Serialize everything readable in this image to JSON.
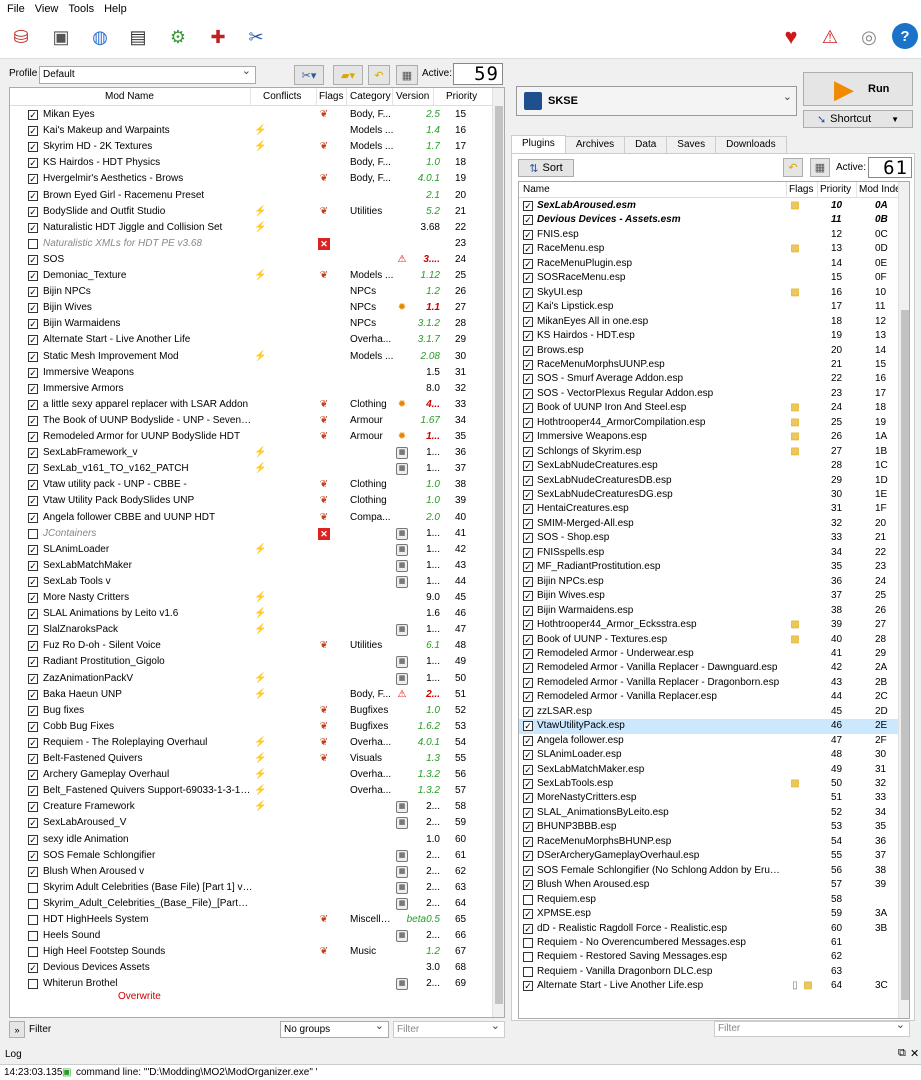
{
  "menu": [
    "File",
    "View",
    "Tools",
    "Help"
  ],
  "profile": {
    "label": "Profile",
    "value": "Default",
    "active_label": "Active:",
    "active_count": "59"
  },
  "executable": {
    "value": "SKSE",
    "run_label": "Run",
    "shortcut_label": "Shortcut"
  },
  "mod_columns": [
    "Mod Name",
    "Conflicts",
    "Flags",
    "Category",
    "Version",
    "Priority"
  ],
  "mods": [
    {
      "c": true,
      "n": "Mikan Eyes",
      "cf": "",
      "fl": "flag",
      "cat": "Body, F...",
      "v": "2.5",
      "vc": "g",
      "p": "15"
    },
    {
      "c": true,
      "n": "Kai's Makeup and Warpaints",
      "cf": "y",
      "fl": "",
      "cat": "Models ...",
      "v": "1.4",
      "vc": "g",
      "p": "16"
    },
    {
      "c": true,
      "n": "Skyrim HD - 2K Textures",
      "cf": "y",
      "fl": "flag",
      "cat": "Models ...",
      "v": "1.7",
      "vc": "g",
      "p": "17"
    },
    {
      "c": true,
      "n": "KS Hairdos - HDT Physics",
      "cf": "",
      "fl": "",
      "cat": "Body, F...",
      "v": "1.0",
      "vc": "g",
      "p": "18"
    },
    {
      "c": true,
      "n": "Hvergelmir's Aesthetics - Brows",
      "cf": "",
      "fl": "flag",
      "cat": "Body, F...",
      "v": "4.0.1",
      "vc": "g",
      "p": "19"
    },
    {
      "c": true,
      "n": "Brown Eyed Girl - Racemenu Preset",
      "cf": "",
      "fl": "",
      "cat": "",
      "v": "2.1",
      "vc": "g",
      "p": "20"
    },
    {
      "c": true,
      "n": "BodySlide and Outfit Studio",
      "cf": "y",
      "fl": "flag",
      "cat": "Utilities",
      "v": "5.2",
      "vc": "g",
      "p": "21"
    },
    {
      "c": true,
      "n": "Naturalistic HDT Jiggle and Collision Set",
      "cf": "y",
      "fl": "",
      "cat": "",
      "v": "3.68",
      "vc": "b",
      "p": "22"
    },
    {
      "c": false,
      "n": "Naturalistic XMLs for HDT PE v3.68",
      "cf": "",
      "fl": "x",
      "cat": "",
      "v": "",
      "vc": "b",
      "p": "23",
      "gray": true
    },
    {
      "c": true,
      "n": "SOS",
      "cf": "",
      "fl": "warn",
      "cat": "",
      "v": "3....",
      "vc": "r",
      "p": "24"
    },
    {
      "c": true,
      "n": "Demoniac_Texture",
      "cf": "y",
      "fl": "flag",
      "cat": "Models ...",
      "v": "1.12",
      "vc": "g",
      "p": "25"
    },
    {
      "c": true,
      "n": "Bijin NPCs",
      "cf": "",
      "fl": "",
      "cat": "NPCs",
      "v": "1.2",
      "vc": "g",
      "p": "26"
    },
    {
      "c": true,
      "n": "Bijin Wives",
      "cf": "",
      "fl": "gear",
      "cat": "NPCs",
      "v": "1.1",
      "vc": "r",
      "p": "27"
    },
    {
      "c": true,
      "n": "Bijin Warmaidens",
      "cf": "",
      "fl": "",
      "cat": "NPCs",
      "v": "3.1.2",
      "vc": "g",
      "p": "28"
    },
    {
      "c": true,
      "n": "Alternate Start - Live Another Life",
      "cf": "",
      "fl": "",
      "cat": "Overha...",
      "v": "3.1.7",
      "vc": "g",
      "p": "29"
    },
    {
      "c": true,
      "n": "Static Mesh Improvement Mod",
      "cf": "g",
      "fl": "",
      "cat": "Models ...",
      "v": "2.08",
      "vc": "g",
      "p": "30"
    },
    {
      "c": true,
      "n": "Immersive Weapons",
      "cf": "",
      "fl": "",
      "cat": "",
      "v": "1.5",
      "vc": "b",
      "p": "31"
    },
    {
      "c": true,
      "n": "Immersive Armors",
      "cf": "",
      "fl": "",
      "cat": "",
      "v": "8.0",
      "vc": "b",
      "p": "32"
    },
    {
      "c": true,
      "n": "a little sexy apparel replacer with LSAR Addon",
      "cf": "",
      "fl": "flag",
      "cat": "Clothing",
      "v": "4...",
      "vc": "r",
      "p": "33",
      "gear": true
    },
    {
      "c": true,
      "n": "The Book of UUNP Bodyslide - UNP - Sevenba...",
      "cf": "",
      "fl": "flag",
      "cat": "Armour",
      "v": "1.67",
      "vc": "g",
      "p": "34"
    },
    {
      "c": true,
      "n": "Remodeled Armor for UUNP BodySlide HDT",
      "cf": "",
      "fl": "flag",
      "cat": "Armour",
      "v": "1...",
      "vc": "r",
      "p": "35",
      "gear": true
    },
    {
      "c": true,
      "n": "SexLabFramework_v",
      "cf": "y",
      "fl": "",
      "cat": "",
      "v": "1...",
      "vc": "b",
      "p": "36",
      "box": true
    },
    {
      "c": true,
      "n": "SexLab_v161_TO_v162_PATCH",
      "cf": "g",
      "fl": "",
      "cat": "",
      "v": "1...",
      "vc": "b",
      "p": "37",
      "box": true
    },
    {
      "c": true,
      "n": "Vtaw utility pack - UNP - CBBE -",
      "cf": "",
      "fl": "flag",
      "cat": "Clothing",
      "v": "1.0",
      "vc": "g",
      "p": "38"
    },
    {
      "c": true,
      "n": "Vtaw Utility Pack BodySlides UNP",
      "cf": "",
      "fl": "flag",
      "cat": "Clothing",
      "v": "1.0",
      "vc": "g",
      "p": "39"
    },
    {
      "c": true,
      "n": "Angela follower CBBE and UUNP HDT",
      "cf": "",
      "fl": "flag",
      "cat": "Compa...",
      "v": "2.0",
      "vc": "g",
      "p": "40"
    },
    {
      "c": false,
      "n": "JContainers",
      "cf": "",
      "fl": "x",
      "cat": "",
      "v": "1...",
      "vc": "b",
      "p": "41",
      "gray": true,
      "box": true
    },
    {
      "c": true,
      "n": "SLAnimLoader",
      "cf": "y",
      "fl": "",
      "cat": "",
      "v": "1...",
      "vc": "b",
      "p": "42",
      "box": true
    },
    {
      "c": true,
      "n": "SexLabMatchMaker",
      "cf": "",
      "fl": "",
      "cat": "",
      "v": "1...",
      "vc": "b",
      "p": "43",
      "box": true
    },
    {
      "c": true,
      "n": "SexLab Tools v",
      "cf": "",
      "fl": "",
      "cat": "",
      "v": "1...",
      "vc": "b",
      "p": "44",
      "box": true
    },
    {
      "c": true,
      "n": "More Nasty Critters",
      "cf": "y",
      "fl": "",
      "cat": "",
      "v": "9.0",
      "vc": "b",
      "p": "45"
    },
    {
      "c": true,
      "n": "SLAL Animations by Leito v1.6",
      "cf": "g",
      "fl": "",
      "cat": "",
      "v": "1.6",
      "vc": "b",
      "p": "46"
    },
    {
      "c": true,
      "n": "SlalZnaroksPack",
      "cf": "g",
      "fl": "",
      "cat": "",
      "v": "1...",
      "vc": "b",
      "p": "47",
      "box": true
    },
    {
      "c": true,
      "n": "Fuz Ro D-oh - Silent Voice",
      "cf": "",
      "fl": "flag",
      "cat": "Utilities",
      "v": "6.1",
      "vc": "g",
      "p": "48"
    },
    {
      "c": true,
      "n": "Radiant Prostitution_Gigolo",
      "cf": "",
      "fl": "",
      "cat": "",
      "v": "1...",
      "vc": "b",
      "p": "49",
      "box": true
    },
    {
      "c": true,
      "n": "ZazAnimationPackV",
      "cf": "g",
      "fl": "",
      "cat": "",
      "v": "1...",
      "vc": "b",
      "p": "50",
      "box": true
    },
    {
      "c": true,
      "n": "Baka Haeun UNP",
      "cf": "g",
      "fl": "",
      "cat": "Body, F...",
      "v": "2...",
      "vc": "r",
      "p": "51",
      "warn": true
    },
    {
      "c": true,
      "n": "Bug fixes",
      "cf": "",
      "fl": "flag",
      "cat": "Bugfixes",
      "v": "1.0",
      "vc": "g",
      "p": "52"
    },
    {
      "c": true,
      "n": "Cobb Bug Fixes",
      "cf": "",
      "fl": "flag",
      "cat": "Bugfixes",
      "v": "1.6.2",
      "vc": "g",
      "p": "53"
    },
    {
      "c": true,
      "n": "Requiem - The Roleplaying Overhaul",
      "cf": "g",
      "fl": "flag",
      "cat": "Overha...",
      "v": "4.0.1",
      "vc": "g",
      "p": "54"
    },
    {
      "c": true,
      "n": "Belt-Fastened Quivers",
      "cf": "g",
      "fl": "flag",
      "cat": "Visuals",
      "v": "1.3",
      "vc": "g",
      "p": "55"
    },
    {
      "c": true,
      "n": "Archery Gameplay Overhaul",
      "cf": "y",
      "fl": "",
      "cat": "Overha...",
      "v": "1.3.2",
      "vc": "g",
      "p": "56"
    },
    {
      "c": true,
      "n": "Belt_Fastened Quivers Support-69033-1-3-155...",
      "cf": "g",
      "fl": "",
      "cat": "Overha...",
      "v": "1.3.2",
      "vc": "g",
      "p": "57"
    },
    {
      "c": true,
      "n": "Creature Framework",
      "cf": "g",
      "fl": "",
      "cat": "",
      "v": "2...",
      "vc": "b",
      "p": "58",
      "box": true
    },
    {
      "c": true,
      "n": "SexLabAroused_V",
      "cf": "",
      "fl": "",
      "cat": "",
      "v": "2...",
      "vc": "b",
      "p": "59",
      "box": true
    },
    {
      "c": true,
      "n": "sexy idle Animation",
      "cf": "",
      "fl": "",
      "cat": "",
      "v": "1.0",
      "vc": "b",
      "p": "60"
    },
    {
      "c": true,
      "n": "SOS Female Schlongifier",
      "cf": "",
      "fl": "",
      "cat": "",
      "v": "2...",
      "vc": "b",
      "p": "61",
      "box": true
    },
    {
      "c": true,
      "n": "Blush When Aroused v",
      "cf": "",
      "fl": "",
      "cat": "",
      "v": "2...",
      "vc": "b",
      "p": "62",
      "box": true
    },
    {
      "c": false,
      "n": "Skyrim Adult Celebrities (Base File) [Part 1] v1....",
      "cf": "",
      "fl": "",
      "cat": "",
      "v": "2...",
      "vc": "b",
      "p": "63",
      "box": true
    },
    {
      "c": false,
      "n": "Skyrim_Adult_Celebrities_(Base_File)_[Part_2]_v...",
      "cf": "",
      "fl": "",
      "cat": "",
      "v": "2...",
      "vc": "b",
      "p": "64",
      "box": true
    },
    {
      "c": false,
      "n": "HDT HighHeels System",
      "cf": "",
      "fl": "flag",
      "cat": "Miscella...",
      "v": "beta0.5",
      "vc": "g",
      "p": "65"
    },
    {
      "c": false,
      "n": "Heels Sound",
      "cf": "",
      "fl": "",
      "cat": "",
      "v": "2...",
      "vc": "b",
      "p": "66",
      "box": true
    },
    {
      "c": false,
      "n": "High Heel Footstep Sounds",
      "cf": "",
      "fl": "flag",
      "cat": "Music",
      "v": "1.2",
      "vc": "g",
      "p": "67"
    },
    {
      "c": true,
      "n": "Devious Devices Assets",
      "cf": "",
      "fl": "",
      "cat": "",
      "v": "3.0",
      "vc": "b",
      "p": "68"
    },
    {
      "c": false,
      "n": "Whiterun Brothel",
      "cf": "",
      "fl": "",
      "cat": "",
      "v": "2...",
      "vc": "b",
      "p": "69",
      "box": true
    }
  ],
  "overwrite_label": "Overwrite",
  "bottom_left": {
    "filter_label": "Filter",
    "groups_value": "No groups",
    "filter_placeholder": "Filter"
  },
  "tabs": [
    "Plugins",
    "Archives",
    "Data",
    "Saves",
    "Downloads"
  ],
  "plugins_toolbar": {
    "sort_label": "Sort",
    "active_label": "Active:",
    "active_count": "61"
  },
  "plugin_columns": [
    "Name",
    "Flags",
    "Priority",
    "Mod Inde"
  ],
  "plugins": [
    {
      "c": true,
      "n": "SexLabAroused.esm",
      "f": "pkg",
      "p": "10",
      "i": "0A",
      "b": true
    },
    {
      "c": true,
      "n": "Devious Devices - Assets.esm",
      "f": "",
      "p": "11",
      "i": "0B",
      "b": true
    },
    {
      "c": true,
      "n": "FNIS.esp",
      "f": "",
      "p": "12",
      "i": "0C"
    },
    {
      "c": true,
      "n": "RaceMenu.esp",
      "f": "pkg",
      "p": "13",
      "i": "0D"
    },
    {
      "c": true,
      "n": "RaceMenuPlugin.esp",
      "f": "",
      "p": "14",
      "i": "0E"
    },
    {
      "c": true,
      "n": "SOSRaceMenu.esp",
      "f": "",
      "p": "15",
      "i": "0F"
    },
    {
      "c": true,
      "n": "SkyUI.esp",
      "f": "pkg",
      "p": "16",
      "i": "10"
    },
    {
      "c": true,
      "n": "Kai's Lipstick.esp",
      "f": "",
      "p": "17",
      "i": "11"
    },
    {
      "c": true,
      "n": "MikanEyes All in one.esp",
      "f": "",
      "p": "18",
      "i": "12"
    },
    {
      "c": true,
      "n": "KS Hairdos - HDT.esp",
      "f": "",
      "p": "19",
      "i": "13"
    },
    {
      "c": true,
      "n": "Brows.esp",
      "f": "",
      "p": "20",
      "i": "14"
    },
    {
      "c": true,
      "n": "RaceMenuMorphsUUNP.esp",
      "f": "",
      "p": "21",
      "i": "15"
    },
    {
      "c": true,
      "n": "SOS - Smurf Average Addon.esp",
      "f": "",
      "p": "22",
      "i": "16"
    },
    {
      "c": true,
      "n": "SOS - VectorPlexus Regular Addon.esp",
      "f": "",
      "p": "23",
      "i": "17"
    },
    {
      "c": true,
      "n": "Book of UUNP Iron And Steel.esp",
      "f": "pkg",
      "p": "24",
      "i": "18"
    },
    {
      "c": true,
      "n": "Hothtrooper44_ArmorCompilation.esp",
      "f": "pkg",
      "p": "25",
      "i": "19"
    },
    {
      "c": true,
      "n": "Immersive Weapons.esp",
      "f": "pkg",
      "p": "26",
      "i": "1A"
    },
    {
      "c": true,
      "n": "Schlongs of Skyrim.esp",
      "f": "pkg",
      "p": "27",
      "i": "1B"
    },
    {
      "c": true,
      "n": "SexLabNudeCreatures.esp",
      "f": "",
      "p": "28",
      "i": "1C"
    },
    {
      "c": true,
      "n": "SexLabNudeCreaturesDB.esp",
      "f": "",
      "p": "29",
      "i": "1D"
    },
    {
      "c": true,
      "n": "SexLabNudeCreaturesDG.esp",
      "f": "",
      "p": "30",
      "i": "1E"
    },
    {
      "c": true,
      "n": "HentaiCreatures.esp",
      "f": "",
      "p": "31",
      "i": "1F"
    },
    {
      "c": true,
      "n": "SMIM-Merged-All.esp",
      "f": "",
      "p": "32",
      "i": "20"
    },
    {
      "c": true,
      "n": "SOS - Shop.esp",
      "f": "",
      "p": "33",
      "i": "21"
    },
    {
      "c": true,
      "n": "FNISspells.esp",
      "f": "",
      "p": "34",
      "i": "22"
    },
    {
      "c": true,
      "n": "MF_RadiantProstitution.esp",
      "f": "",
      "p": "35",
      "i": "23"
    },
    {
      "c": true,
      "n": "Bijin NPCs.esp",
      "f": "",
      "p": "36",
      "i": "24"
    },
    {
      "c": true,
      "n": "Bijin Wives.esp",
      "f": "",
      "p": "37",
      "i": "25"
    },
    {
      "c": true,
      "n": "Bijin Warmaidens.esp",
      "f": "",
      "p": "38",
      "i": "26"
    },
    {
      "c": true,
      "n": "Hothtrooper44_Armor_Ecksstra.esp",
      "f": "pkg",
      "p": "39",
      "i": "27"
    },
    {
      "c": true,
      "n": "Book of UUNP - Textures.esp",
      "f": "pkg",
      "p": "40",
      "i": "28"
    },
    {
      "c": true,
      "n": "Remodeled Armor - Underwear.esp",
      "f": "",
      "p": "41",
      "i": "29"
    },
    {
      "c": true,
      "n": "Remodeled Armor - Vanilla Replacer - Dawnguard.esp",
      "f": "",
      "p": "42",
      "i": "2A"
    },
    {
      "c": true,
      "n": "Remodeled Armor - Vanilla Replacer - Dragonborn.esp",
      "f": "",
      "p": "43",
      "i": "2B"
    },
    {
      "c": true,
      "n": "Remodeled Armor - Vanilla Replacer.esp",
      "f": "",
      "p": "44",
      "i": "2C"
    },
    {
      "c": true,
      "n": "zzLSAR.esp",
      "f": "",
      "p": "45",
      "i": "2D"
    },
    {
      "c": true,
      "n": "VtawUtilityPack.esp",
      "f": "",
      "p": "46",
      "i": "2E",
      "hl": true
    },
    {
      "c": true,
      "n": "Angela follower.esp",
      "f": "",
      "p": "47",
      "i": "2F"
    },
    {
      "c": true,
      "n": "SLAnimLoader.esp",
      "f": "",
      "p": "48",
      "i": "30"
    },
    {
      "c": true,
      "n": "SexLabMatchMaker.esp",
      "f": "",
      "p": "49",
      "i": "31"
    },
    {
      "c": true,
      "n": "SexLabTools.esp",
      "f": "pkg",
      "p": "50",
      "i": "32"
    },
    {
      "c": true,
      "n": "MoreNastyCritters.esp",
      "f": "",
      "p": "51",
      "i": "33"
    },
    {
      "c": true,
      "n": "SLAL_AnimationsByLeito.esp",
      "f": "",
      "p": "52",
      "i": "34"
    },
    {
      "c": true,
      "n": "BHUNP3BBB.esp",
      "f": "",
      "p": "53",
      "i": "35"
    },
    {
      "c": true,
      "n": "RaceMenuMorphsBHUNP.esp",
      "f": "",
      "p": "54",
      "i": "36"
    },
    {
      "c": true,
      "n": "DSerArcheryGameplayOverhaul.esp",
      "f": "",
      "p": "55",
      "i": "37"
    },
    {
      "c": true,
      "n": "SOS Female Schlongifier (No Schlong Addon by Erundil).esp",
      "f": "",
      "p": "56",
      "i": "38"
    },
    {
      "c": true,
      "n": "Blush When Aroused.esp",
      "f": "",
      "p": "57",
      "i": "39"
    },
    {
      "c": false,
      "n": "Requiem.esp",
      "f": "",
      "p": "58",
      "i": ""
    },
    {
      "c": true,
      "n": "XPMSE.esp",
      "f": "",
      "p": "59",
      "i": "3A"
    },
    {
      "c": true,
      "n": "dD - Realistic Ragdoll Force - Realistic.esp",
      "f": "",
      "p": "60",
      "i": "3B"
    },
    {
      "c": false,
      "n": "Requiem - No Overencumbered Messages.esp",
      "f": "",
      "p": "61",
      "i": ""
    },
    {
      "c": false,
      "n": "Requiem - Restored Saving Messages.esp",
      "f": "",
      "p": "62",
      "i": ""
    },
    {
      "c": false,
      "n": "Requiem - Vanilla Dragonborn DLC.esp",
      "f": "",
      "p": "63",
      "i": ""
    },
    {
      "c": true,
      "n": "Alternate Start - Live Another Life.esp",
      "f": "pkg2",
      "p": "64",
      "i": "3C"
    }
  ],
  "plugins_filter_placeholder": "Filter",
  "log": {
    "label": "Log",
    "timestamp": "14:23:03.135",
    "message": "command line: '\"D:\\Modding\\MO2\\ModOrganizer.exe\" '"
  }
}
